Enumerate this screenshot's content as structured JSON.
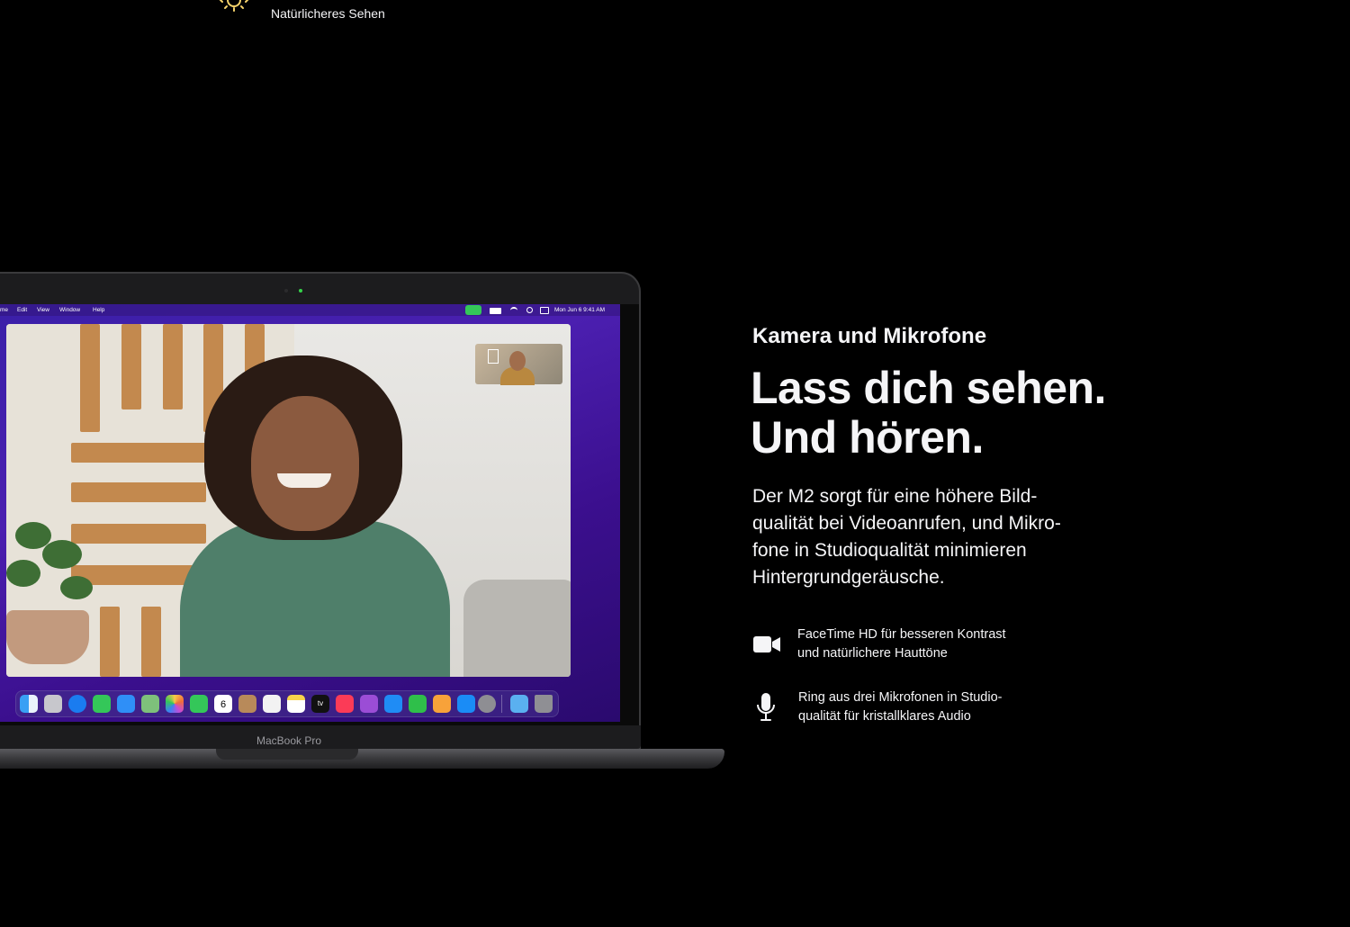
{
  "top_feature": {
    "label": "Natürlicheres Sehen",
    "icon": "sun-icon"
  },
  "laptop": {
    "model_label": "MacBook Pro",
    "menubar": {
      "app_fragment": "me",
      "items": [
        "Edit",
        "View",
        "Window",
        "Help"
      ],
      "status": "Mon Jun 6  9:41 AM"
    },
    "dock_calendar_day": "6",
    "dock_tv_label": "tv",
    "colors": {
      "wallpaper": "#3a1fa8",
      "camera_led": "#35d34a"
    }
  },
  "section": {
    "eyebrow": "Kamera und Mikrofone",
    "headline_lines": [
      "Lass dich sehen.",
      "Und hören."
    ],
    "body_lines": [
      "Der M2 sorgt für eine höhere Bild-",
      "qualität bei Videoanrufen, und Mikro-",
      "fone in Studioqualität minimieren",
      "Hintergrundgeräusche."
    ]
  },
  "features": [
    {
      "icon": "video-camera-icon",
      "lines": [
        "FaceTime HD für besseren Kontrast",
        "und natürlichere Hauttöne"
      ]
    },
    {
      "icon": "microphone-icon",
      "lines": [
        "Ring aus drei Mikrofonen in Studio-",
        "qualität für kristallklares Audio"
      ]
    }
  ]
}
